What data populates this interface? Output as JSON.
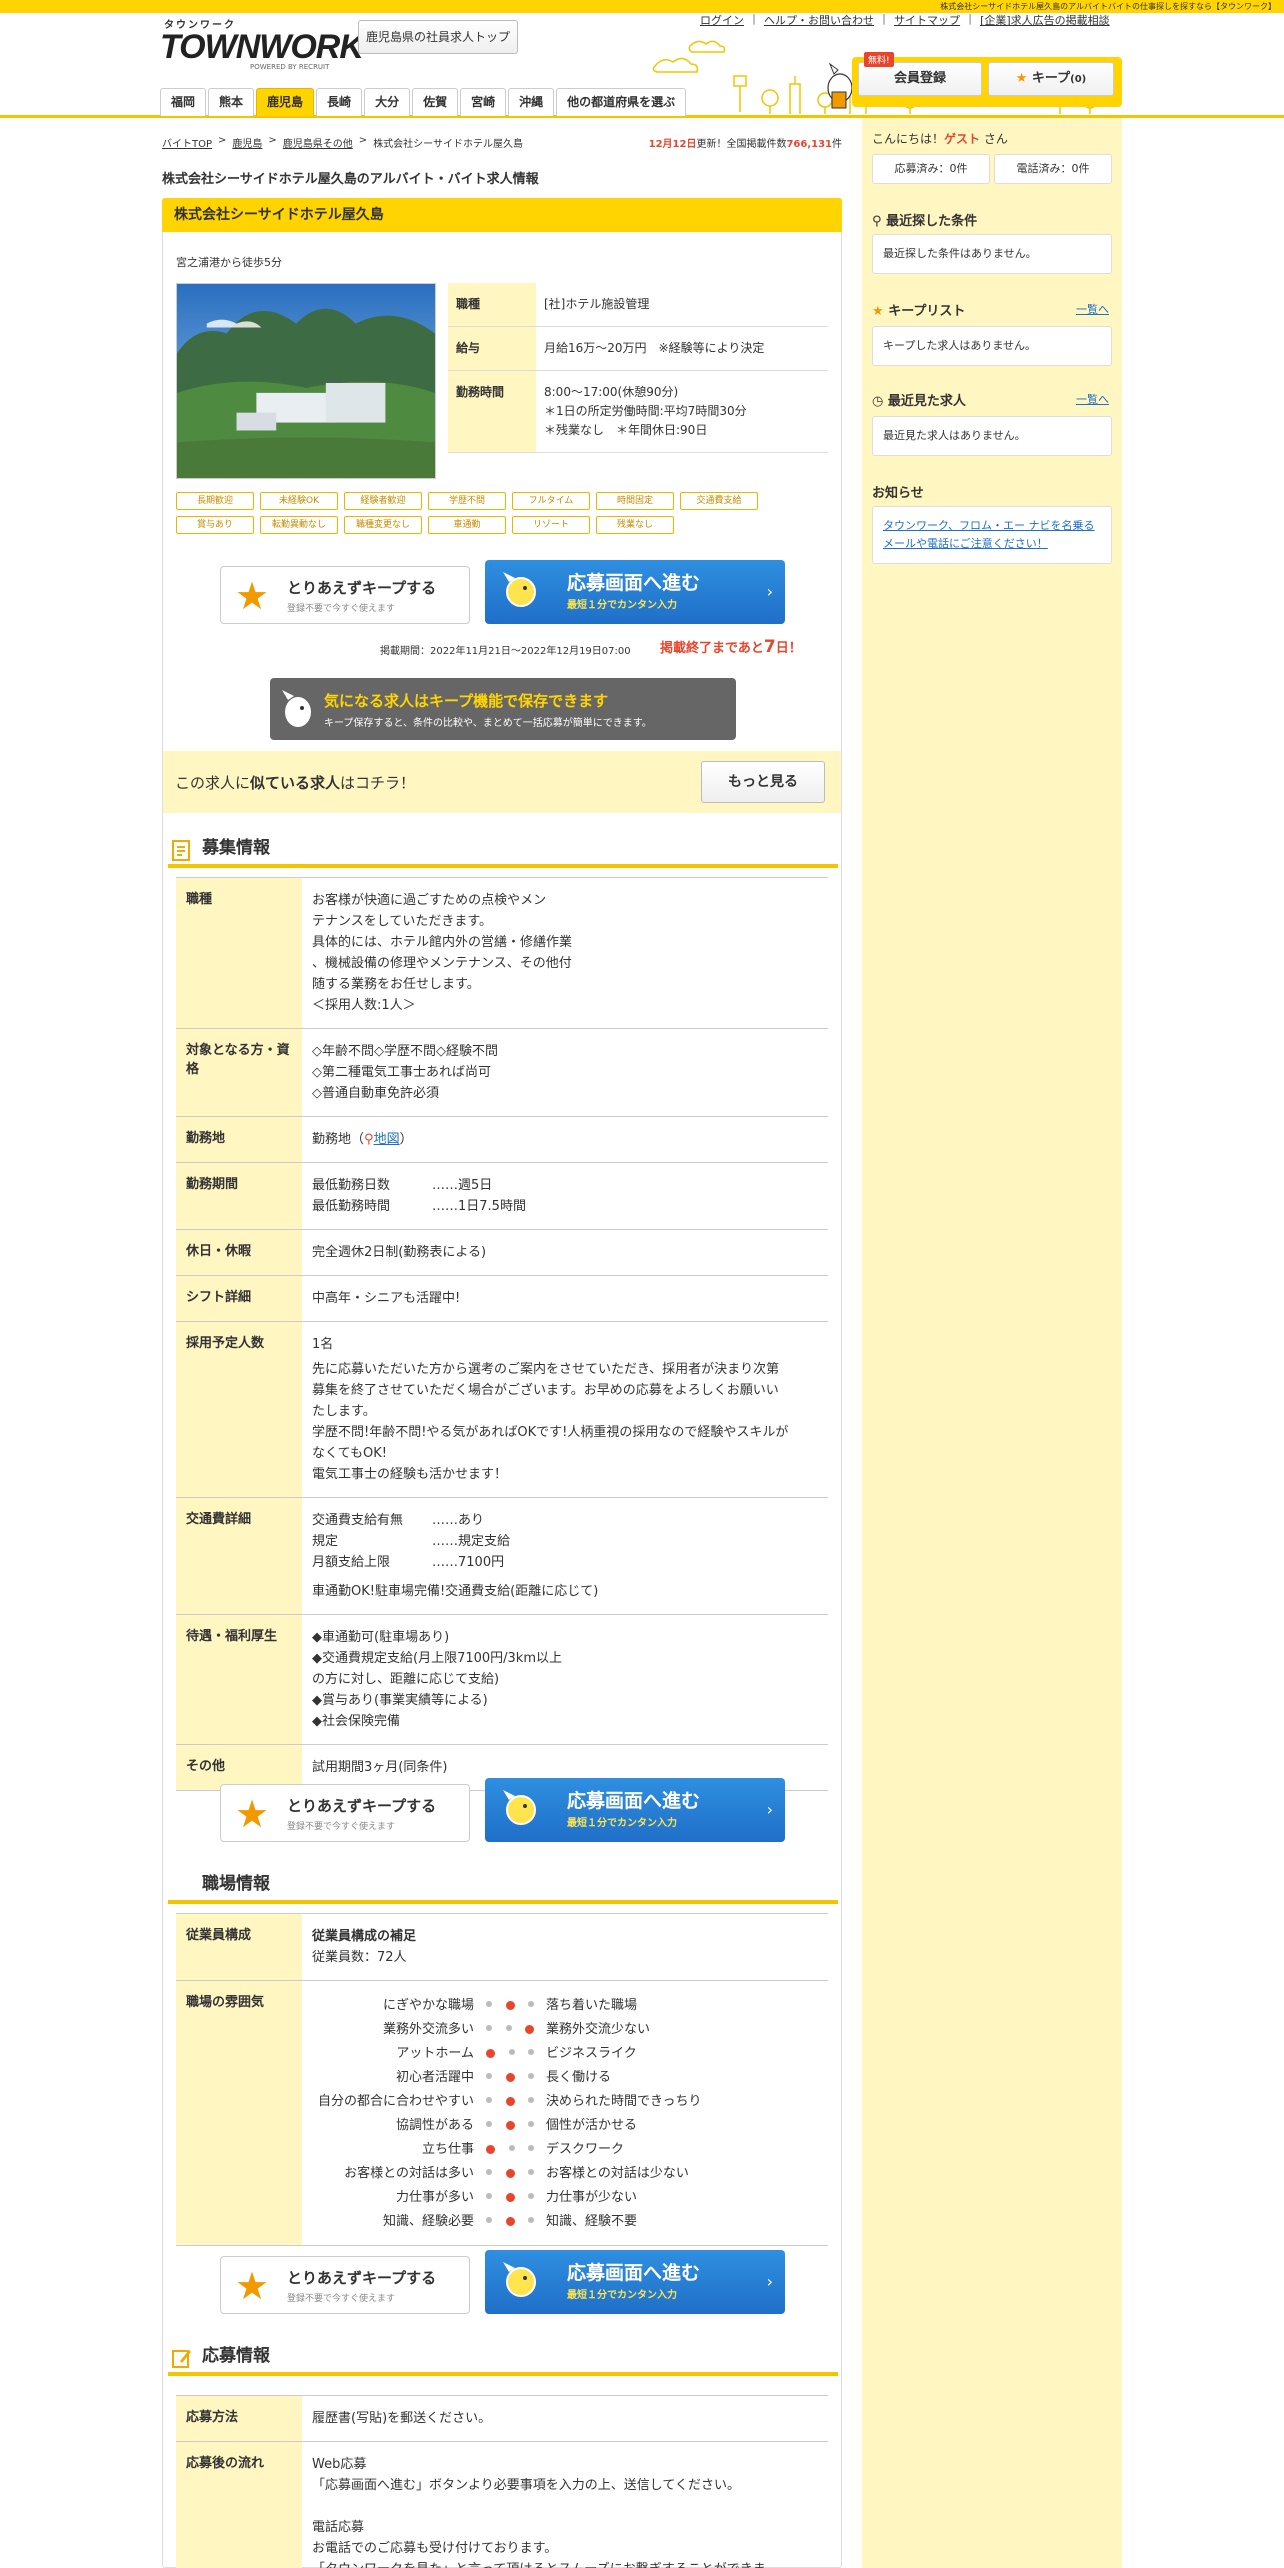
{
  "topbar": "株式会社シーサイドホテル屋久島のアルバイトバイトの仕事探しを探すなら【タウンワーク】",
  "logo": {
    "kana": "タウンワーク",
    "main": "TOWNWORK",
    "powered": "POWERED BY RECRUIT"
  },
  "area_top": "鹿児島県の社員求人トップ",
  "top_links": [
    "ログイン",
    "ヘルプ・お問い合わせ",
    "サイトマップ",
    "[企業]求人広告の掲載相談"
  ],
  "nav": [
    "福岡",
    "熊本",
    "鹿児島",
    "長崎",
    "大分",
    "佐賀",
    "宮崎",
    "沖縄",
    "他の都道府県を選ぶ"
  ],
  "member": {
    "free": "無料!",
    "register": "会員登録",
    "keep": "キープ",
    "keep_count": "(0)"
  },
  "breadcrumb": [
    "バイトTOP",
    "鹿児島",
    "鹿児島県その他",
    "株式会社シーサイドホテル屋久島"
  ],
  "update": {
    "date": "12月12日",
    "text1": "更新！全国掲載件数",
    "count": "766,131",
    "text2": "件"
  },
  "page_title": "株式会社シーサイドホテル屋久島のアルバイト・バイト求人情報",
  "company": "株式会社シーサイドホテル屋久島",
  "access": "宮之浦港から徒歩5分",
  "summary": [
    {
      "k": "職種",
      "v": "[社]ホテル施設管理"
    },
    {
      "k": "給与",
      "v": "月給16万～20万円　※経験等により決定"
    },
    {
      "k": "勤務時間",
      "v1": "8:00～17:00(休憩90分)",
      "v2": "＊1日の所定労働時間:平均7時間30分",
      "v3": "＊残業なし　＊年間休日:90日"
    }
  ],
  "tags": [
    "長期歓迎",
    "未経験OK",
    "経験者歓迎",
    "学歴不問",
    "フルタイム",
    "時間固定",
    "交通費支給",
    "賞与あり",
    "転勤異動なし",
    "職種変更なし",
    "車通勤",
    "リゾート",
    "残業なし"
  ],
  "keep_btn": {
    "title": "とりあえずキープする",
    "sub": "登録不要で今すぐ使えます"
  },
  "apply_btn": {
    "title": "応募画面へ進む",
    "sub": "最短１分でカンタン入力"
  },
  "period": "掲載期間：2022年11月21日～2022年12月19日07:00",
  "remain": {
    "pre": "掲載終了まであと",
    "num": "7",
    "post": "日！"
  },
  "keep_banner": {
    "title": "気になる求人はキープ機能で保存できます",
    "sub": "キープ保存すると、条件の比較や、まとめて一括応募が簡単にできます。"
  },
  "similar": {
    "pre": "この求人に",
    "bold": "似ている求人",
    "post": "はコチラ！",
    "btn": "もっと見る"
  },
  "sections": {
    "recruit": "募集情報",
    "workplace": "職場情報",
    "apply": "応募情報"
  },
  "recruit": {
    "job_k": "職種",
    "job_v": [
      "お客様が快適に過ごすための点検やメン",
      "テナンスをしていただきます。",
      "具体的には、ホテル館内外の営繕・修繕作業",
      "、機械設備の修理やメンテナンス、その他付",
      "随する業務をお任せします。",
      "＜採用人数:1人＞"
    ],
    "target_k": "対象となる方・資格",
    "target_v": [
      "◇年齢不問◇学歴不問◇経験不問",
      "◇第二種電気工事士あれば尚可",
      "◇普通自動車免許必須"
    ],
    "place_k": "勤務地",
    "place_v": "勤務地",
    "place_map": "地図",
    "term_k": "勤務期間",
    "term": [
      {
        "a": "最低勤務日数",
        "b": "……週5日"
      },
      {
        "a": "最低勤務時間",
        "b": "……1日7.5時間"
      }
    ],
    "holiday_k": "休日・休暇",
    "holiday_v": "完全週休2日制(勤務表による)",
    "shift_k": "シフト詳細",
    "shift_v": "中高年・シニアも活躍中!",
    "hire_k": "採用予定人数",
    "hire_v": [
      "1名",
      "先に応募いただいた方から選考のご案内をさせていただき、採用者が決まり次第",
      "募集を終了させていただく場合がございます。お早めの応募をよろしくお願いい",
      "たします。",
      "学歴不問!年齢不問!やる気があればOKです!人柄重視の採用なので経験やスキルが",
      "なくてもOK!",
      "電気工事士の経験も活かせます！"
    ],
    "trans_k": "交通費詳細",
    "trans": [
      {
        "a": "交通費支給有無",
        "b": "……あり"
      },
      {
        "a": "規定",
        "b": "……規定支給"
      },
      {
        "a": "月額支給上限",
        "b": "……7100円"
      }
    ],
    "trans_note": "車通勤OK!駐車場完備!交通費支給(距離に応じて)",
    "benefit_k": "待遇・福利厚生",
    "benefit_v": [
      "◆車通勤可(駐車場あり)",
      "◆交通費規定支給(月上限7100円/3km以上",
      "の方に対し、距離に応じて支給)",
      "◆賞与あり(事業実績等による)",
      "◆社会保険完備"
    ],
    "other_k": "その他",
    "other_v": "試用期間3ヶ月(同条件)"
  },
  "workplace": {
    "staff_k": "従業員構成",
    "staff_title": "従業員構成の補足",
    "staff_v": "従業員数：72人",
    "mood_k": "職場の雰囲気",
    "moods": [
      {
        "l": "にぎやかな職場",
        "r": "落ち着いた職場",
        "pos": 1
      },
      {
        "l": "業務外交流多い",
        "r": "業務外交流少ない",
        "pos": 2
      },
      {
        "l": "アットホーム",
        "r": "ビジネスライク",
        "pos": 0
      },
      {
        "l": "初心者活躍中",
        "r": "長く働ける",
        "pos": 1
      },
      {
        "l": "自分の都合に合わせやすい",
        "r": "決められた時間できっちり",
        "pos": 1
      },
      {
        "l": "協調性がある",
        "r": "個性が活かせる",
        "pos": 1
      },
      {
        "l": "立ち仕事",
        "r": "デスクワーク",
        "pos": 0
      },
      {
        "l": "お客様との対話は多い",
        "r": "お客様との対話は少ない",
        "pos": 1
      },
      {
        "l": "力仕事が多い",
        "r": "力仕事が少ない",
        "pos": 1
      },
      {
        "l": "知識、経験必要",
        "r": "知識、経験不要",
        "pos": 1
      }
    ]
  },
  "apply": {
    "method_k": "応募方法",
    "method_v": "履歴書(写貼)を郵送ください。",
    "flow_k": "応募後の流れ",
    "flow_v": [
      "Web応募",
      "「応募画面へ進む」ボタンより必要事項を入力の上、送信してください。",
      "",
      "電話応募",
      "お電話でのご応募も受け付けております。",
      "「タウンワークを見た」と言って頂けるとスムーズにお繋ぎすることができま"
    ]
  },
  "sidebar": {
    "hello": "こんにちは！",
    "guest": "ゲスト",
    "san": "さん",
    "applied": "応募済み：0件",
    "called": "電話済み：0件",
    "recent_cond": "最近探した条件",
    "recent_cond_v": "最近探した条件はありません。",
    "keep_list": "キープリスト",
    "keep_more": "一覧へ",
    "keep_v": "キープした求人はありません。",
    "recent_view": "最近見た求人",
    "view_more": "一覧へ",
    "view_v": "最近見た求人はありません。",
    "notice": "お知らせ",
    "notice_v": "タウンワーク、フロム・エー ナビを名乗るメールや電話にご注意ください！"
  }
}
